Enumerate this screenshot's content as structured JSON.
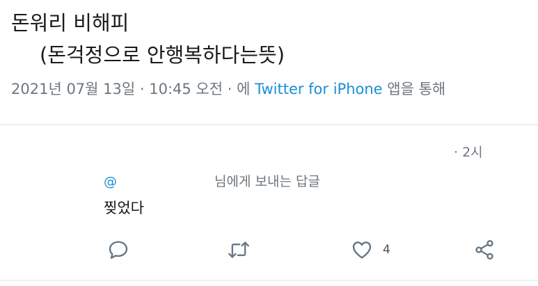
{
  "tweet": {
    "text_line1": "돈워리 비해피",
    "text_line2": "(돈걱정으로 안행복하다는뜻)",
    "meta": {
      "date": "2021년 07월 13일",
      "sep1": " · ",
      "time": "10:45 오전",
      "sep2": " · ",
      "via_prefix": "에 ",
      "via_app": "Twitter for iPhone",
      "via_suffix": " 앱을 통해"
    }
  },
  "reply": {
    "time": "· 2시",
    "reply_to_mention": "@",
    "reply_to_suffix": "님에게 보내는 답글",
    "text": "찢었다",
    "actions": {
      "like_count": "4"
    }
  },
  "colors": {
    "link": "#1b8ed6",
    "meta_text": "#6e767d",
    "icon": "#657786",
    "divider": "#e9edef"
  },
  "icons": [
    "reply-icon",
    "retweet-icon",
    "like-icon",
    "share-icon"
  ]
}
